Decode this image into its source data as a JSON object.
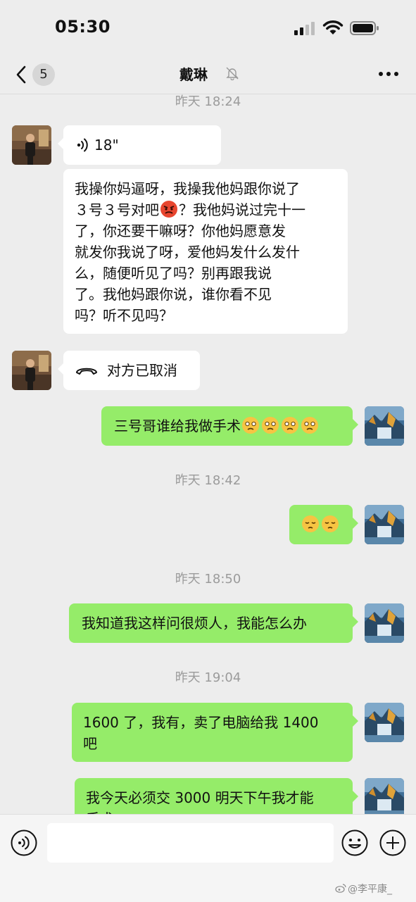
{
  "status_bar": {
    "time": "05:30"
  },
  "nav": {
    "badge_count": "5",
    "title": "戴琳"
  },
  "colors": {
    "sent_bubble": "#95ec69",
    "received_bubble": "#ffffff",
    "background": "#ededed"
  },
  "messages": {
    "ts1": "昨天 18:24",
    "voice_duration": "18\"",
    "m2": {
      "l1": "我操你妈逼呀，我操我他妈跟你说了",
      "l2a": "３号３号对吧",
      "l2b": "？我他妈说过完十一",
      "l3": "了，你还要干嘛呀？你他妈愿意发",
      "l4": "就发你我说了呀，爱他妈发什么发什",
      "l5": "么，随便听见了吗？别再跟我说",
      "l6": "了。我他妈跟你说，谁你看不见",
      "l7": "吗？听不见吗？"
    },
    "call_status": "对方已取消",
    "m4": "三号哥谁给我做手术",
    "ts2": "昨天 18:42",
    "ts3": "昨天 18:50",
    "m6": "我知道我这样问很烦人，我能怎么办",
    "ts4": "昨天 19:04",
    "m7": {
      "l1": "1600 了，我有，卖了电脑给我 1400",
      "l2": "吧"
    },
    "m8": {
      "l1": "我今天必须交 3000 明天下午我才能",
      "l2": "手术"
    }
  },
  "input": {
    "placeholder": ""
  },
  "watermark": "@李平康_"
}
